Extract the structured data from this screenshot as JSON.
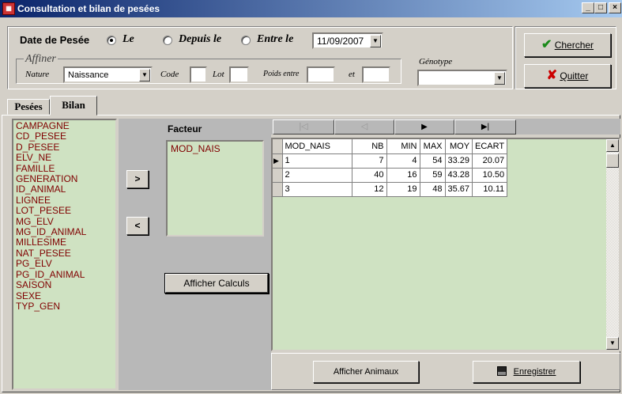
{
  "window": {
    "title": "Consultation et bilan de pesées",
    "minimize": "_",
    "maximize": "□",
    "close": "×"
  },
  "filters": {
    "date_label": "Date de Pesée",
    "radio_le": "Le",
    "radio_depuis": "Depuis le",
    "radio_entre": "Entre le",
    "selected_radio": "Le",
    "date_value": "11/09/2007",
    "affiner_label": "Affiner",
    "nature_label": "Nature",
    "nature_value": "Naissance",
    "code_label": "Code",
    "lot_label": "Lot",
    "poids_label": "Poids entre",
    "et_label": "et",
    "genotype_label": "Génotype",
    "genotype_value": ""
  },
  "buttons": {
    "chercher": "Chercher",
    "quitter": "Quitter",
    "add": ">",
    "remove": "<",
    "afficher_calculs": "Afficher Calculs",
    "afficher_animaux": "Afficher Animaux",
    "enregistrer": "Enregistrer"
  },
  "tabs": [
    "Pesées",
    "Bilan"
  ],
  "active_tab": "Bilan",
  "fields": [
    "CAMPAGNE",
    "CD_PESEE",
    "D_PESEE",
    "ELV_NE",
    "FAMILLE",
    "GENERATION",
    "ID_ANIMAL",
    "LIGNEE",
    "LOT_PESEE",
    "MG_ELV",
    "MG_ID_ANIMAL",
    "MILLESIME",
    "NAT_PESEE",
    "PG_ELV",
    "PG_ID_ANIMAL",
    "SAISON",
    "SEXE",
    "TYP_GEN"
  ],
  "facteur": {
    "label": "Facteur",
    "items": [
      "MOD_NAIS"
    ]
  },
  "navigator": [
    "|◁",
    "◁",
    "▶",
    "▶|"
  ],
  "grid": {
    "columns": [
      "MOD_NAIS",
      "NB",
      "MIN",
      "MAX",
      "MOY",
      "ECART"
    ],
    "rows": [
      [
        "1",
        "7",
        "4",
        "54",
        "33.29",
        "20.07"
      ],
      [
        "2",
        "40",
        "16",
        "59",
        "43.28",
        "10.50"
      ],
      [
        "3",
        "12",
        "19",
        "48",
        "35.67",
        "10.11"
      ]
    ],
    "current_row": 0
  },
  "icons": {
    "check": "check-icon",
    "cross": "x-icon",
    "save": "floppy-disk-icon"
  },
  "colors": {
    "list_bg": "#cfe2c2",
    "list_text": "#800000",
    "check": "#1a8a1a",
    "cross": "#cc0000"
  }
}
